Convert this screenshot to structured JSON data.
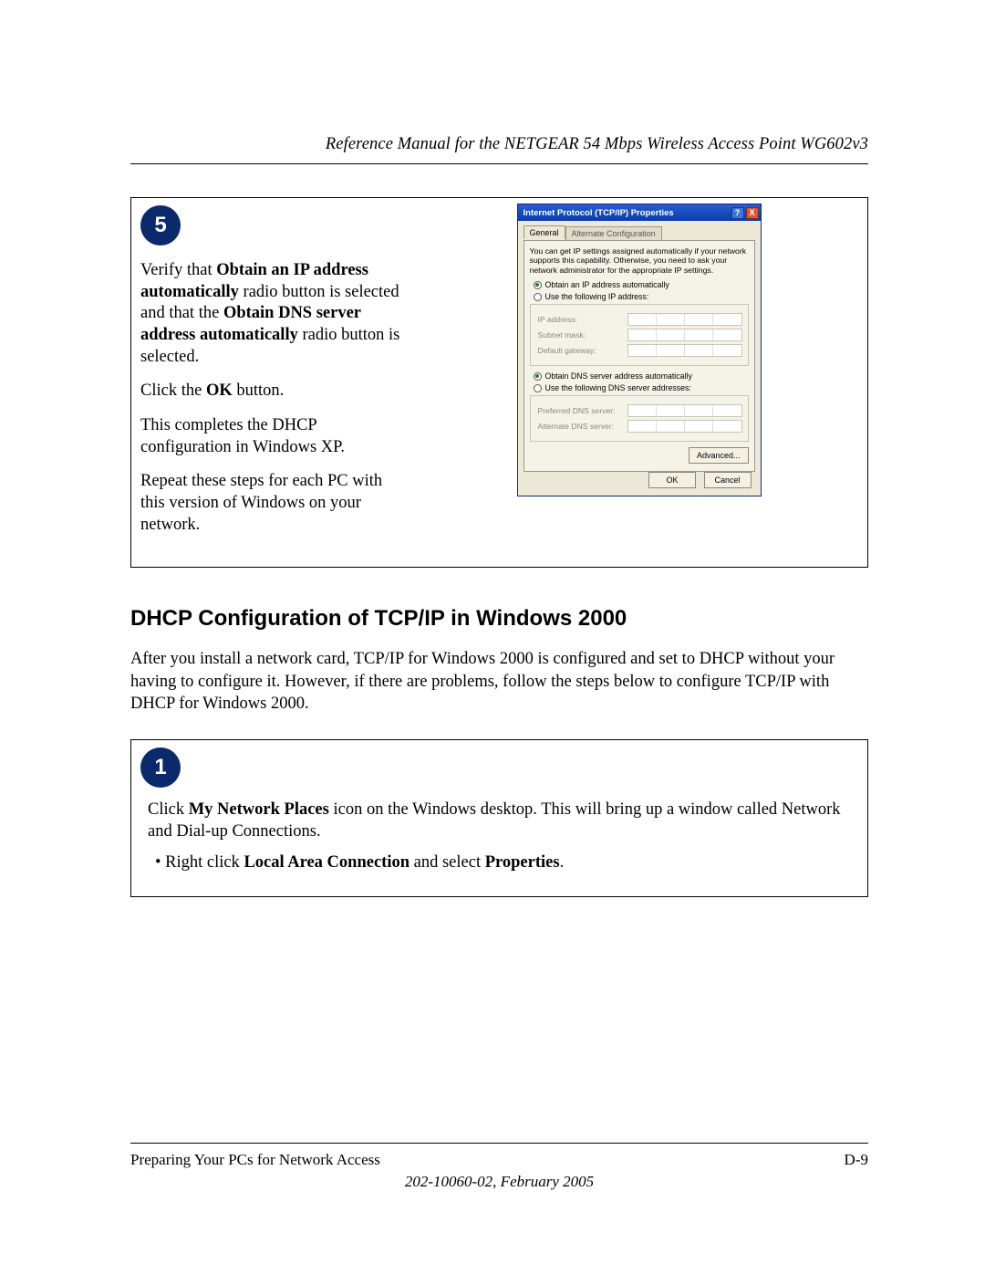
{
  "header": {
    "title": "Reference Manual for the NETGEAR 54 Mbps Wireless Access Point WG602v3"
  },
  "step5": {
    "badge": "5",
    "p1a": "Verify that ",
    "p1b": "Obtain an IP address automatically",
    "p1c": " radio button is selected and that the ",
    "p1d": "Obtain DNS server address automatically",
    "p1e": " radio button is selected.",
    "p2a": "Click the ",
    "p2b": "OK",
    "p2c": " button.",
    "p3": "This completes the DHCP configuration in Windows XP.",
    "p4": "Repeat these steps for each PC with this version of Windows on your network."
  },
  "dialog": {
    "title": "Internet Protocol (TCP/IP) Properties",
    "help": "?",
    "close": "X",
    "tab_general": "General",
    "tab_alt": "Alternate Configuration",
    "desc": "You can get IP settings assigned automatically if your network supports this capability. Otherwise, you need to ask your network administrator for the appropriate IP settings.",
    "r_ip_auto": "Obtain an IP address automatically",
    "r_ip_manual": "Use the following IP address:",
    "lbl_ip": "IP address:",
    "lbl_mask": "Subnet mask:",
    "lbl_gw": "Default gateway:",
    "r_dns_auto": "Obtain DNS server address automatically",
    "r_dns_manual": "Use the following DNS server addresses:",
    "lbl_pref": "Preferred DNS server:",
    "lbl_alt": "Alternate DNS server:",
    "btn_adv": "Advanced...",
    "btn_ok": "OK",
    "btn_cancel": "Cancel"
  },
  "section": {
    "heading": "DHCP Configuration of TCP/IP in Windows 2000",
    "para": "After you install a network card, TCP/IP for Windows 2000 is configured and set to DHCP without your having to configure it. However, if there are problems, follow the steps below to configure TCP/IP with DHCP for Windows 2000."
  },
  "step1": {
    "badge": "1",
    "p1a": "Click ",
    "p1b": "My Network Places",
    "p1c": " icon on the Windows desktop. This will bring up a window called Network and Dial-up Connections.",
    "li1a": "Right click ",
    "li1b": "Local Area Connection",
    "li1c": " and select ",
    "li1d": "Properties",
    "li1e": "."
  },
  "footer": {
    "left": "Preparing Your PCs for Network Access",
    "right": "D-9",
    "pub": "202-10060-02, February 2005"
  }
}
